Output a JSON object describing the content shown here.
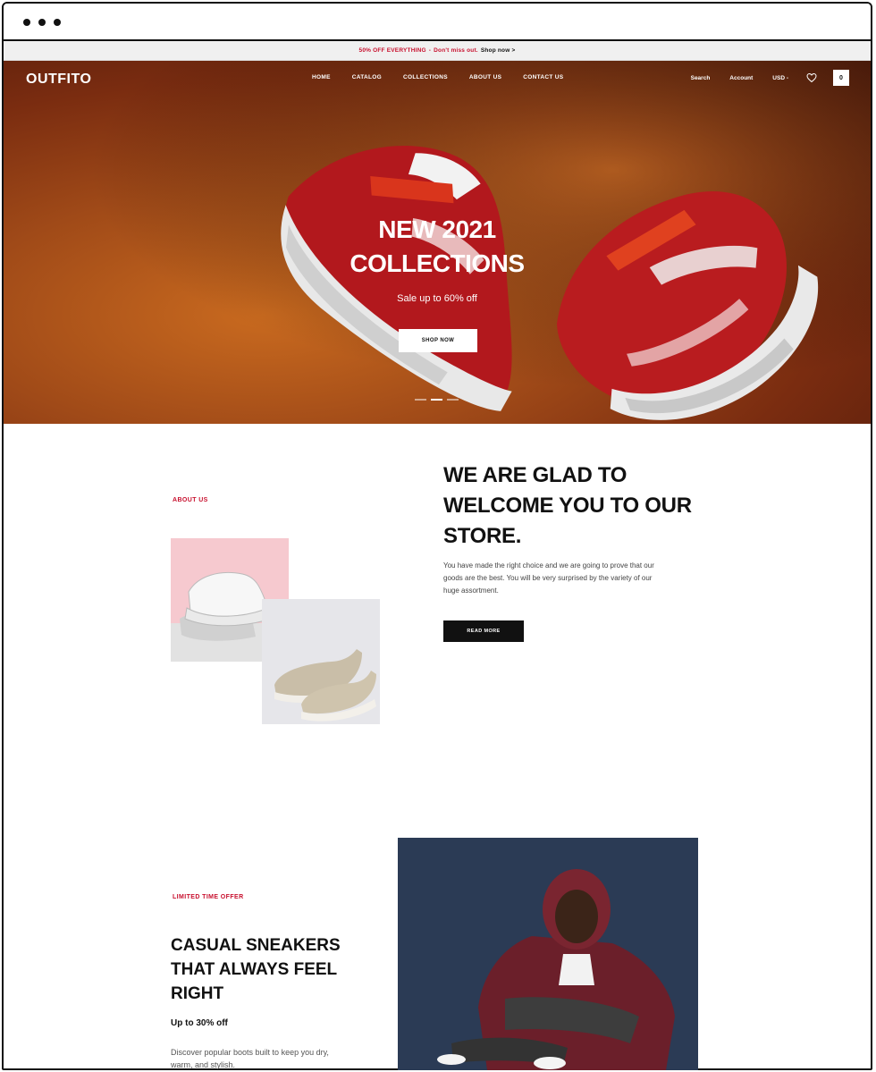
{
  "announcement": {
    "highlight": "50% OFF EVERYTHING",
    "separator": "-",
    "text": "Don't miss out.",
    "cta": "Shop now >"
  },
  "header": {
    "logo": "OUTFITO",
    "menu": [
      "HOME",
      "CATALOG",
      "COLLECTIONS",
      "ABOUT US",
      "CONTACT US"
    ],
    "search": "Search",
    "account": "Account",
    "currency": "USD -",
    "cart_count": "0"
  },
  "hero": {
    "title_line1": "NEW 2021",
    "title_line2": "COLLECTIONS",
    "subtitle": "Sale up to 60% off",
    "button": "SHOP NOW",
    "slides": 3,
    "active_slide": 2
  },
  "about": {
    "eyebrow": "ABOUT US",
    "heading_line1": "WE ARE GLAD TO",
    "heading_line2": "WELCOME YOU TO OUR",
    "heading_line3": "STORE.",
    "text": "You have made the right choice and we are going to prove that our goods are the best. You will be very surprised by the variety of our huge assortment.",
    "button": "READ MORE"
  },
  "promo": {
    "eyebrow": "LIMITED TIME OFFER",
    "heading_line1": "CASUAL SNEAKERS",
    "heading_line2": "THAT ALWAYS FEEL",
    "heading_line3": "RIGHT",
    "offer": "Up to 30% off",
    "text": "Discover popular boots built to keep you dry, warm, and stylish."
  },
  "colors": {
    "accent": "#c8102e",
    "dark": "#111111",
    "hero_bg": "#a04a18",
    "pink_tile": "#f6c9cf",
    "grey_tile": "#e6e6ea",
    "navy_tile": "#2b3b55"
  },
  "icons": [
    "heart-icon",
    "cart-icon"
  ]
}
